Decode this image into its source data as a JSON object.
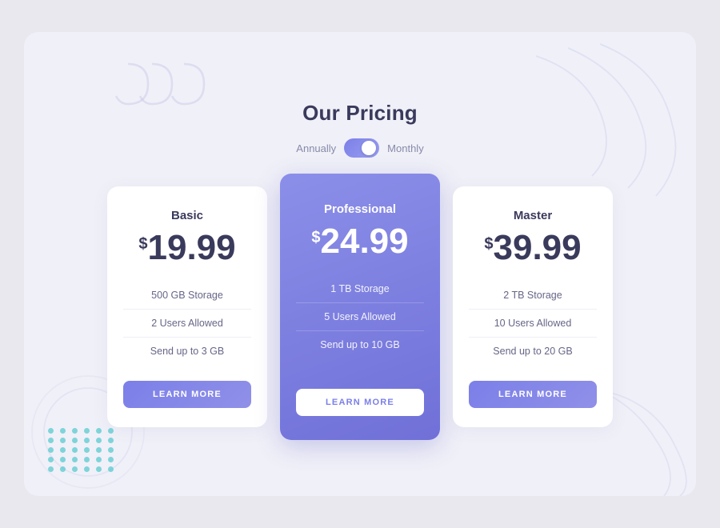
{
  "page": {
    "title": "Our Pricing",
    "toggle": {
      "left_label": "Annually",
      "right_label": "Monthly"
    },
    "plans": [
      {
        "id": "basic",
        "name": "Basic",
        "price_symbol": "$",
        "price": "19.99",
        "features": [
          "500 GB Storage",
          "2 Users Allowed",
          "Send up to 3 GB"
        ],
        "cta": "LEARN MORE",
        "featured": false
      },
      {
        "id": "professional",
        "name": "Professional",
        "price_symbol": "$",
        "price": "24.99",
        "features": [
          "1 TB Storage",
          "5 Users Allowed",
          "Send up to 10 GB"
        ],
        "cta": "LEARN MORE",
        "featured": true
      },
      {
        "id": "master",
        "name": "Master",
        "price_symbol": "$",
        "price": "39.99",
        "features": [
          "2 TB Storage",
          "10 Users Allowed",
          "Send up to 20 GB"
        ],
        "cta": "LEARN MORE",
        "featured": false
      }
    ]
  }
}
